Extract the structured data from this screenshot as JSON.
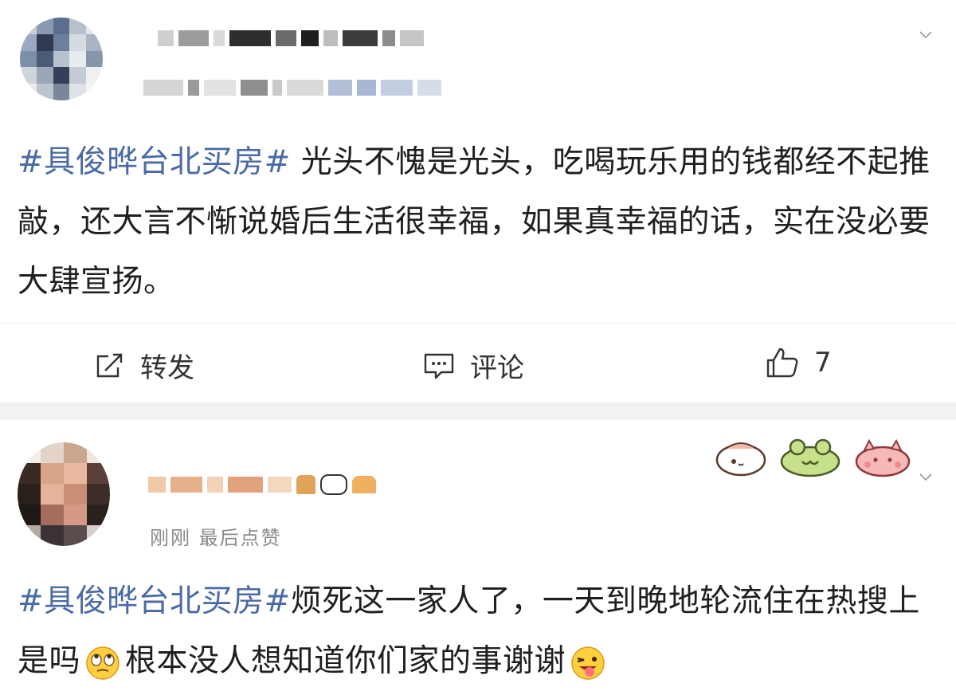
{
  "post1": {
    "hashtag": "#具俊晔台北买房#",
    "body": " 光头不愧是光头，吃喝玩乐用的钱都经不起推敲，还大言不惭说婚后生活很幸福，如果真幸福的话，实在没必要大肆宣扬。",
    "actions": {
      "repost_label": "转发",
      "comment_label": "评论",
      "like_count": "7"
    }
  },
  "post2": {
    "meta": "刚刚  最后点赞",
    "hashtag": "#具俊晔台北买房#",
    "body_part1": "烦死这一家人了，一天到晚地轮流住在热搜上是吗",
    "body_part2": "根本没人想知道你们家的事谢谢"
  },
  "icons": {
    "repost": "repost-icon",
    "comment": "comment-icon",
    "like": "thumbs-up-icon",
    "expand": "chevron-down-icon",
    "emoji1": "eye-roll-emoji",
    "emoji2": "tongue-wink-emoji"
  },
  "colors": {
    "hashtag": "#4a6aa5",
    "text": "#1f1f1f",
    "divider": "#f2f2f2"
  }
}
